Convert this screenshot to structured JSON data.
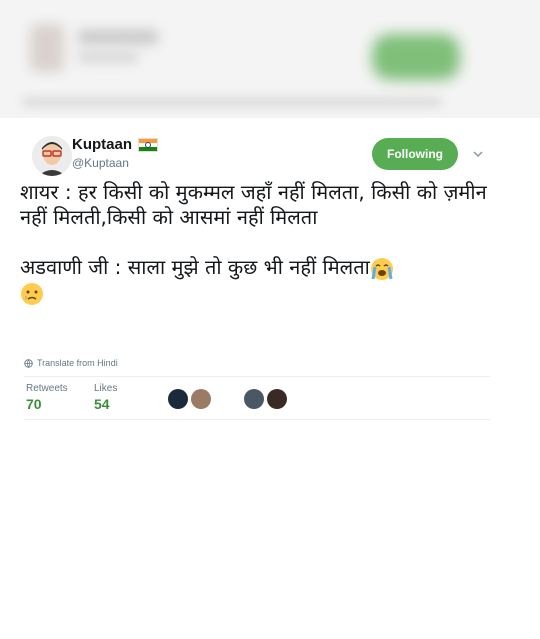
{
  "user": {
    "name": "Kuptaan",
    "handle": "@Kuptaan",
    "flag": "india-flag-icon"
  },
  "follow_button": "Following",
  "tweet_lines": [
    "शायर : हर किसी को मुकम्मल जहाँ नहीं मिलता, किसी को ज़मीन नहीं मिलती,किसी को आसमां नहीं मिलता",
    "अडवाणी जी : साला मुझे तो कुछ भी नहीं मिलता"
  ],
  "emojis": [
    "loudly-crying-face-icon",
    "crying-face-icon"
  ],
  "translate": "Translate from Hindi",
  "stats": {
    "retweets_label": "Retweets",
    "retweets": "70",
    "likes_label": "Likes",
    "likes": "54"
  },
  "colors": {
    "follow_green": "#58ad54",
    "count_green": "#3b8e3c"
  }
}
